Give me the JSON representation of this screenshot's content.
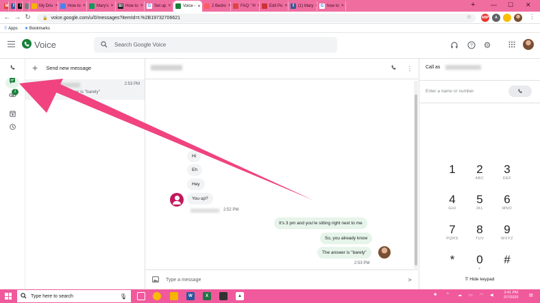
{
  "browser": {
    "tabs": [
      {
        "label": "",
        "favicon": "gmail-icon",
        "color": "#db4437",
        "glyph": "M"
      },
      {
        "label": "",
        "favicon": "facebook-icon",
        "color": "#3b5998",
        "glyph": "f"
      },
      {
        "label": "",
        "favicon": "imdb-icon",
        "color": "#111111",
        "glyph": "I"
      },
      {
        "label": "",
        "favicon": "page-icon",
        "color": "#7a7a7a",
        "glyph": ""
      },
      {
        "label": "My Driv",
        "favicon": "drive-icon",
        "color": "#f4b400",
        "glyph": ""
      },
      {
        "label": "How to",
        "favicon": "doc-icon",
        "color": "#4285f4",
        "glyph": ""
      },
      {
        "label": "Mary's",
        "favicon": "sheets-icon",
        "color": "#0f9d58",
        "glyph": ""
      },
      {
        "label": "How to",
        "favicon": "bi-icon",
        "color": "#222222",
        "glyph": "BI"
      },
      {
        "label": "Set up",
        "favicon": "google-icon",
        "color": "#ffffff",
        "glyph": "G"
      },
      {
        "label": "Voice -",
        "favicon": "voice-icon",
        "color": "#188038",
        "glyph": ""
      },
      {
        "label": "2 Bedro",
        "favicon": "airbnb-icon",
        "color": "#ff5a5f",
        "glyph": ""
      },
      {
        "label": "FAQ: \"H",
        "favicon": "faq-icon",
        "color": "#d44",
        "glyph": ""
      },
      {
        "label": "Edit Po",
        "favicon": "edit-icon",
        "color": "#c33",
        "glyph": ""
      },
      {
        "label": "(1) Mary",
        "favicon": "facebook-icon",
        "color": "#3b5998",
        "glyph": "f"
      },
      {
        "label": "how to",
        "favicon": "google-icon",
        "color": "#ffffff",
        "glyph": "G"
      }
    ],
    "active_tab": 9,
    "url": "voice.google.com/u/0/messages?itemId=t.%2B19732706621",
    "bookmarks": [
      "Apps",
      "Bookmarks"
    ]
  },
  "app": {
    "brand": "Voice",
    "search_placeholder": "Search Google Voice",
    "rail_badge": "1"
  },
  "list": {
    "new_message": "Send new message",
    "conversations": [
      {
        "time": "2:53 PM",
        "snippet": "You: The answer is \"barely\""
      }
    ]
  },
  "thread": {
    "incoming": [
      {
        "text": "Hi"
      },
      {
        "text": "Eh"
      },
      {
        "text": "Hey"
      },
      {
        "text": "You up?"
      }
    ],
    "incoming_time": "2:52 PM",
    "outgoing": [
      {
        "text": "It's 3 pm and you're sitting right next to me"
      },
      {
        "text": "So, you already know"
      },
      {
        "text": "The answer is \"barely\""
      }
    ],
    "outgoing_time": "2:53 PM",
    "compose_placeholder": "Type a message"
  },
  "dialer": {
    "call_as": "Call as",
    "input_placeholder": "Enter a name or number",
    "keys": [
      {
        "d": "1",
        "l": ""
      },
      {
        "d": "2",
        "l": "ABC"
      },
      {
        "d": "3",
        "l": "DEF"
      },
      {
        "d": "4",
        "l": "GHI"
      },
      {
        "d": "5",
        "l": "JKL"
      },
      {
        "d": "6",
        "l": "MNO"
      },
      {
        "d": "7",
        "l": "PQRS"
      },
      {
        "d": "8",
        "l": "TUV"
      },
      {
        "d": "9",
        "l": "WXYZ"
      },
      {
        "d": "*",
        "l": ""
      },
      {
        "d": "0",
        "l": "+"
      },
      {
        "d": "#",
        "l": ""
      }
    ],
    "hide_keypad": "Hide keypad"
  },
  "taskbar": {
    "search_placeholder": "Type here to search",
    "time": "3:41 PM",
    "date": "2/7/2020"
  },
  "annotation": {
    "color": "#f0437f"
  }
}
